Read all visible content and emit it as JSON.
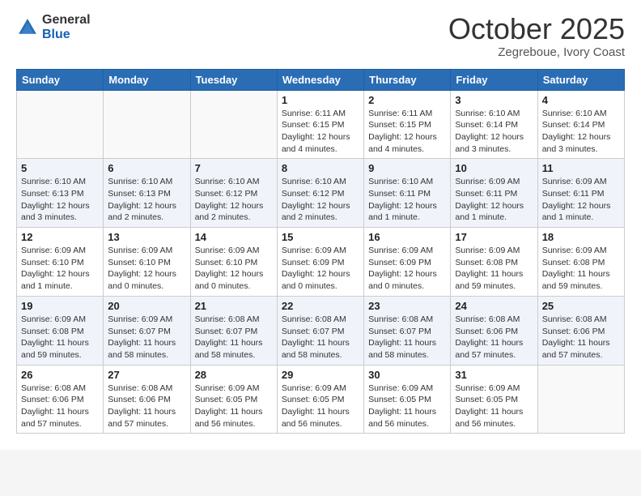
{
  "header": {
    "logo_general": "General",
    "logo_blue": "Blue",
    "month": "October 2025",
    "location": "Zegreboue, Ivory Coast"
  },
  "weekdays": [
    "Sunday",
    "Monday",
    "Tuesday",
    "Wednesday",
    "Thursday",
    "Friday",
    "Saturday"
  ],
  "weeks": [
    [
      {
        "day": "",
        "info": ""
      },
      {
        "day": "",
        "info": ""
      },
      {
        "day": "",
        "info": ""
      },
      {
        "day": "1",
        "info": "Sunrise: 6:11 AM\nSunset: 6:15 PM\nDaylight: 12 hours\nand 4 minutes."
      },
      {
        "day": "2",
        "info": "Sunrise: 6:11 AM\nSunset: 6:15 PM\nDaylight: 12 hours\nand 4 minutes."
      },
      {
        "day": "3",
        "info": "Sunrise: 6:10 AM\nSunset: 6:14 PM\nDaylight: 12 hours\nand 3 minutes."
      },
      {
        "day": "4",
        "info": "Sunrise: 6:10 AM\nSunset: 6:14 PM\nDaylight: 12 hours\nand 3 minutes."
      }
    ],
    [
      {
        "day": "5",
        "info": "Sunrise: 6:10 AM\nSunset: 6:13 PM\nDaylight: 12 hours\nand 3 minutes."
      },
      {
        "day": "6",
        "info": "Sunrise: 6:10 AM\nSunset: 6:13 PM\nDaylight: 12 hours\nand 2 minutes."
      },
      {
        "day": "7",
        "info": "Sunrise: 6:10 AM\nSunset: 6:12 PM\nDaylight: 12 hours\nand 2 minutes."
      },
      {
        "day": "8",
        "info": "Sunrise: 6:10 AM\nSunset: 6:12 PM\nDaylight: 12 hours\nand 2 minutes."
      },
      {
        "day": "9",
        "info": "Sunrise: 6:10 AM\nSunset: 6:11 PM\nDaylight: 12 hours\nand 1 minute."
      },
      {
        "day": "10",
        "info": "Sunrise: 6:09 AM\nSunset: 6:11 PM\nDaylight: 12 hours\nand 1 minute."
      },
      {
        "day": "11",
        "info": "Sunrise: 6:09 AM\nSunset: 6:11 PM\nDaylight: 12 hours\nand 1 minute."
      }
    ],
    [
      {
        "day": "12",
        "info": "Sunrise: 6:09 AM\nSunset: 6:10 PM\nDaylight: 12 hours\nand 1 minute."
      },
      {
        "day": "13",
        "info": "Sunrise: 6:09 AM\nSunset: 6:10 PM\nDaylight: 12 hours\nand 0 minutes."
      },
      {
        "day": "14",
        "info": "Sunrise: 6:09 AM\nSunset: 6:10 PM\nDaylight: 12 hours\nand 0 minutes."
      },
      {
        "day": "15",
        "info": "Sunrise: 6:09 AM\nSunset: 6:09 PM\nDaylight: 12 hours\nand 0 minutes."
      },
      {
        "day": "16",
        "info": "Sunrise: 6:09 AM\nSunset: 6:09 PM\nDaylight: 12 hours\nand 0 minutes."
      },
      {
        "day": "17",
        "info": "Sunrise: 6:09 AM\nSunset: 6:08 PM\nDaylight: 11 hours\nand 59 minutes."
      },
      {
        "day": "18",
        "info": "Sunrise: 6:09 AM\nSunset: 6:08 PM\nDaylight: 11 hours\nand 59 minutes."
      }
    ],
    [
      {
        "day": "19",
        "info": "Sunrise: 6:09 AM\nSunset: 6:08 PM\nDaylight: 11 hours\nand 59 minutes."
      },
      {
        "day": "20",
        "info": "Sunrise: 6:09 AM\nSunset: 6:07 PM\nDaylight: 11 hours\nand 58 minutes."
      },
      {
        "day": "21",
        "info": "Sunrise: 6:08 AM\nSunset: 6:07 PM\nDaylight: 11 hours\nand 58 minutes."
      },
      {
        "day": "22",
        "info": "Sunrise: 6:08 AM\nSunset: 6:07 PM\nDaylight: 11 hours\nand 58 minutes."
      },
      {
        "day": "23",
        "info": "Sunrise: 6:08 AM\nSunset: 6:07 PM\nDaylight: 11 hours\nand 58 minutes."
      },
      {
        "day": "24",
        "info": "Sunrise: 6:08 AM\nSunset: 6:06 PM\nDaylight: 11 hours\nand 57 minutes."
      },
      {
        "day": "25",
        "info": "Sunrise: 6:08 AM\nSunset: 6:06 PM\nDaylight: 11 hours\nand 57 minutes."
      }
    ],
    [
      {
        "day": "26",
        "info": "Sunrise: 6:08 AM\nSunset: 6:06 PM\nDaylight: 11 hours\nand 57 minutes."
      },
      {
        "day": "27",
        "info": "Sunrise: 6:08 AM\nSunset: 6:06 PM\nDaylight: 11 hours\nand 57 minutes."
      },
      {
        "day": "28",
        "info": "Sunrise: 6:09 AM\nSunset: 6:05 PM\nDaylight: 11 hours\nand 56 minutes."
      },
      {
        "day": "29",
        "info": "Sunrise: 6:09 AM\nSunset: 6:05 PM\nDaylight: 11 hours\nand 56 minutes."
      },
      {
        "day": "30",
        "info": "Sunrise: 6:09 AM\nSunset: 6:05 PM\nDaylight: 11 hours\nand 56 minutes."
      },
      {
        "day": "31",
        "info": "Sunrise: 6:09 AM\nSunset: 6:05 PM\nDaylight: 11 hours\nand 56 minutes."
      },
      {
        "day": "",
        "info": ""
      }
    ]
  ]
}
